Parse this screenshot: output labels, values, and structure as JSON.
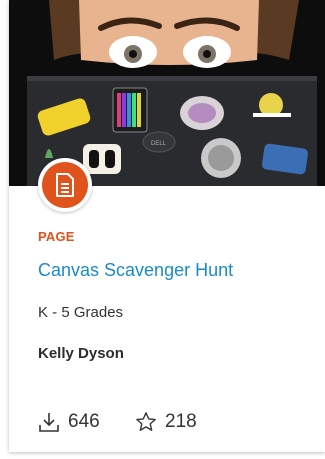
{
  "resource": {
    "type_label": "PAGE",
    "title": "Canvas Scavenger Hunt",
    "grades": "K - 5 Grades",
    "author": "Kelly Dyson",
    "downloads": "646",
    "favorites": "218"
  },
  "icons": {
    "badge": "document-icon",
    "downloads": "download-icon",
    "favorites": "star-icon"
  },
  "thumbnail": {
    "description_sticker_text": "DELL"
  },
  "colors": {
    "accent": "#e0531c",
    "link": "#1a8bc9",
    "text": "#333333"
  }
}
